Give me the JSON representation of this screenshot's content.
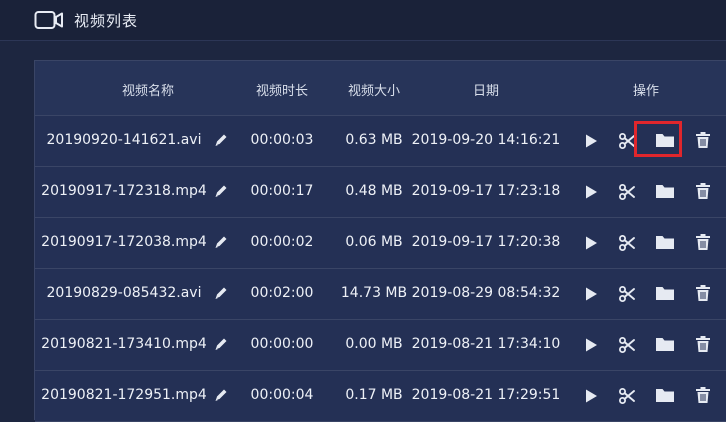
{
  "header": {
    "title": "视频列表",
    "icon": "video-camera-icon"
  },
  "table": {
    "columns": {
      "name": "视频名称",
      "duration": "视频时长",
      "size": "视频大小",
      "date": "日期",
      "actions": "操作"
    },
    "rows": [
      {
        "name": "20190920-141621.avi",
        "duration": "00:00:03",
        "size": "0.63 MB",
        "date": "2019-09-20 14:16:21"
      },
      {
        "name": "20190917-172318.mp4",
        "duration": "00:00:17",
        "size": "0.48 MB",
        "date": "2019-09-17 17:23:18"
      },
      {
        "name": "20190917-172038.mp4",
        "duration": "00:00:02",
        "size": "0.06 MB",
        "date": "2019-09-17 17:20:38"
      },
      {
        "name": "20190829-085432.avi",
        "duration": "00:02:00",
        "size": "14.73 MB",
        "date": "2019-08-29 08:54:32"
      },
      {
        "name": "20190821-173410.mp4",
        "duration": "00:00:00",
        "size": "0.00 MB",
        "date": "2019-08-21 17:34:10"
      },
      {
        "name": "20190821-172951.mp4",
        "duration": "00:00:04",
        "size": "0.17 MB",
        "date": "2019-08-21 17:29:51"
      }
    ],
    "action_icons": [
      "edit-icon",
      "play-icon",
      "cut-icon",
      "folder-icon",
      "delete-icon"
    ],
    "highlighted_action": "folder-icon (row 1)"
  },
  "colors": {
    "background": "#1d2640",
    "row": "#243055",
    "border": "#3a4566",
    "icon": "#e6eaf2",
    "highlight": "#e0262c"
  }
}
